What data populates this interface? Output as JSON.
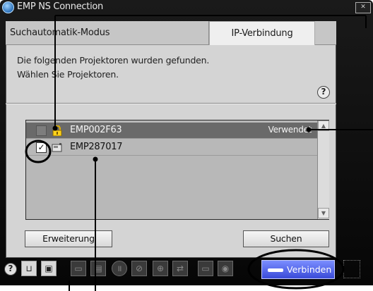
{
  "window": {
    "title": "EMP NS Connection"
  },
  "tabs": [
    {
      "label": "Suchautomatik-Modus"
    },
    {
      "label": "IP-Verbindung"
    }
  ],
  "message": {
    "line1": "Die folgenden Projektoren wurden gefunden.",
    "line2": "Wählen Sie Projektoren."
  },
  "help_label": "?",
  "projectors": [
    {
      "name": "EMP002F63",
      "status": "Verwendet",
      "checked": false,
      "locked": true
    },
    {
      "name": "EMP287017",
      "status": "",
      "checked": true,
      "locked": false
    }
  ],
  "checkbox_mark": "✓",
  "buttons": {
    "advanced": "Erweiterung",
    "search": "Suchen",
    "connect": "Verbinden"
  },
  "toolbar_icons": [
    "help-icon",
    "projector-status-icon",
    "display-settings-icon",
    "monitor-icon",
    "document-icon",
    "pause-icon",
    "no-display-icon",
    "zoom-icon",
    "swap-icon",
    "tape-icon",
    "disconnect-icon"
  ],
  "colors": {
    "connect_button": "#4f5fe8",
    "selected_row": "#6a6a6a",
    "list_background": "#b8b8b8"
  }
}
